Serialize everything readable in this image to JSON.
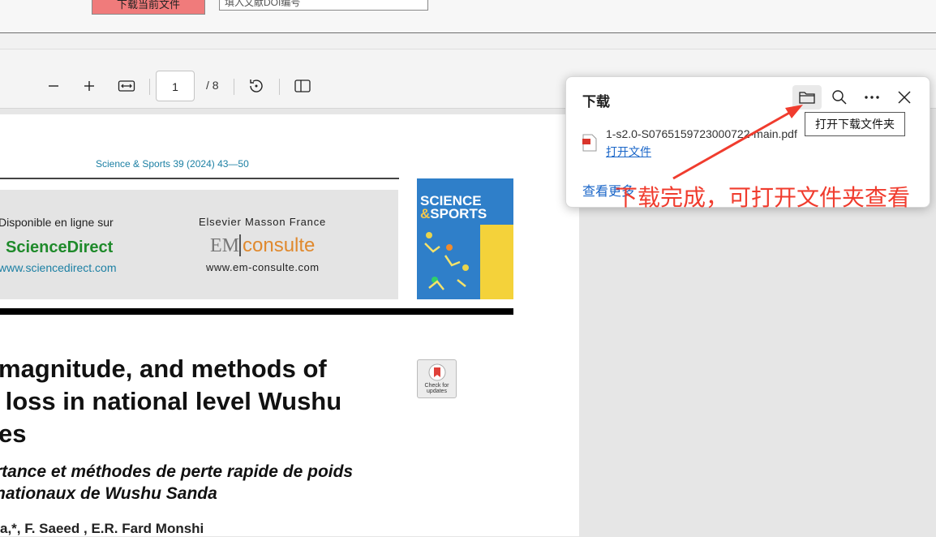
{
  "top_strip": {
    "red_button_label": "下载当前文件",
    "doi_input_value": "填入文献DOI编号"
  },
  "pdf_toolbar": {
    "page_current": "1",
    "page_total": "/ 8"
  },
  "pdf_page": {
    "journal_ref": "Science & Sports 39 (2024) 43—50",
    "banner": {
      "available_online": "Disponible en ligne sur",
      "sciencedirect_name": "ScienceDirect",
      "sciencedirect_url": "www.sciencedirect.com",
      "elsevier": "Elsevier Masson France",
      "em_logo_left": "EM",
      "em_logo_right": "consulte",
      "em_url": "www.em-consulte.com"
    },
    "cover": {
      "line1": "SCIENCE",
      "line2_amp": "&",
      "line2": "SPORTS"
    },
    "title_en": "magnitude, and methods of\n loss in national level Wushu\nes",
    "title_fr": "rtance et méthodes de perte rapide de poids\nnationaux de Wushu Sanda",
    "check_updates": "Check for updates",
    "authors_fragment": "a,*, F. Saeed      , E.R. Fard Monshi"
  },
  "downloads_panel": {
    "title": "下载",
    "file_name": "1-s2.0-S0765159723000722-main.pdf",
    "open_file": "打开文件",
    "see_more": "查看更多",
    "tooltip": "打开下载文件夹",
    "icons": [
      "folder-icon",
      "search-icon",
      "more-icon",
      "close-icon"
    ]
  },
  "annotation": {
    "text": "下载完成，可打开文件夹查看",
    "color": "#f03c2e"
  }
}
